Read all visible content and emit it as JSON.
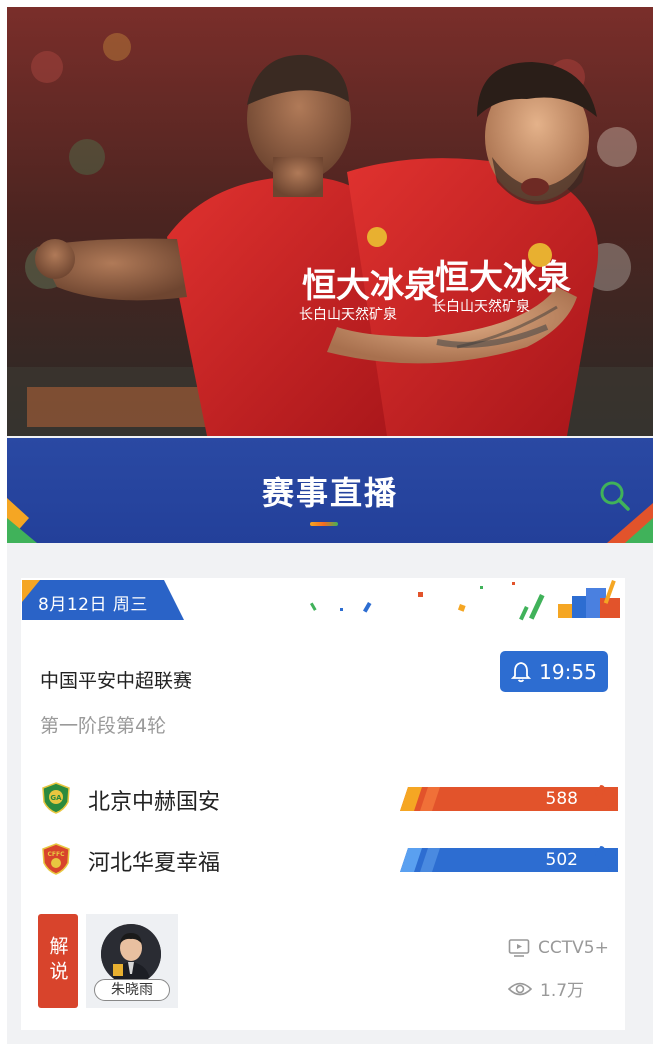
{
  "banner": {
    "title": "赛事直播"
  },
  "match": {
    "date": "8月12日 周三",
    "league": "中国平安中超联赛",
    "round": "第一阶段第4轮",
    "time": "19:55"
  },
  "teams": [
    {
      "name": "北京中赫国安",
      "votes": "588",
      "logo_color": "#2b8a3e",
      "bar_color": "#e2532b",
      "thumb_color": "#e2532b"
    },
    {
      "name": "河北华夏幸福",
      "votes": "502",
      "logo_color": "#d8442c",
      "bar_color": "#2d6dd1",
      "thumb_color": "#2d6dd1"
    }
  ],
  "commentary": {
    "label": "解说",
    "commentator": "朱晓雨"
  },
  "broadcast": {
    "channel": "CCTV5+",
    "views": "1.7万"
  },
  "hero": {
    "jersey_text": "恒大冰泉",
    "jersey_subtext": "长白山天然矿泉"
  },
  "colors": {
    "banner": "#2a49a3",
    "accent_blue": "#2d6dd1",
    "accent_red": "#e2532b",
    "accent_orange": "#f5a623",
    "accent_green": "#40b25a"
  },
  "icons": {
    "search": "search-icon",
    "bell": "bell-icon",
    "thumb": "thumbs-up-icon",
    "tv": "tv-icon",
    "eye": "eye-icon"
  }
}
